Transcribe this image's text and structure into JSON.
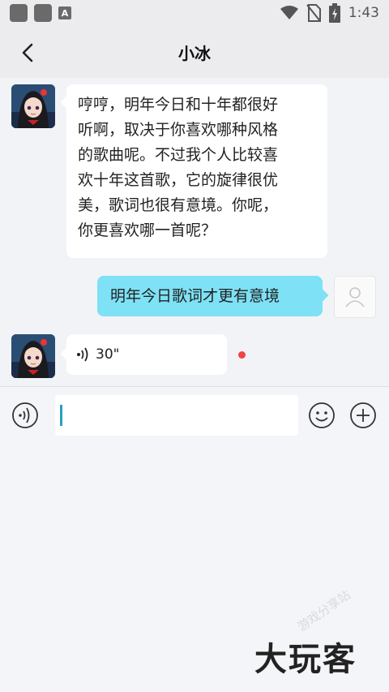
{
  "status_bar": {
    "time": "1:43",
    "a_badge": "A",
    "icons": [
      "app-square-icon",
      "app-square-icon",
      "a-badge-icon",
      "wifi-icon",
      "no-sim-icon",
      "battery-charging-icon"
    ]
  },
  "header": {
    "title": "小冰",
    "back_icon": "chevron-left-icon"
  },
  "messages": [
    {
      "sender": "bot",
      "lines": [
        "哼哼，明年今日和十年都很好",
        "听啊，取决于你喜欢哪种风格",
        "的歌曲呢。不过我个人比较喜",
        "欢十年这首歌，它的旋律很优",
        "美，歌词也很有意境。你呢，",
        "你更喜欢哪一首呢？"
      ]
    },
    {
      "sender": "me",
      "text": "明年今日歌词才更有意境"
    },
    {
      "sender": "bot",
      "type": "voice",
      "duration": "30\""
    }
  ],
  "input_bar": {
    "voice_icon": "voice-toggle-icon",
    "input_value": "",
    "emoji_icon": "emoji-icon",
    "plus_icon": "plus-icon"
  },
  "watermark": {
    "text": "大玩客",
    "sub": "游戏分享站"
  },
  "colors": {
    "my_bubble": "#7ee1f5",
    "bot_bubble": "#ffffff",
    "background": "#f2f3f6",
    "caret": "#29a0bd",
    "unread_dot": "#ee4444"
  }
}
